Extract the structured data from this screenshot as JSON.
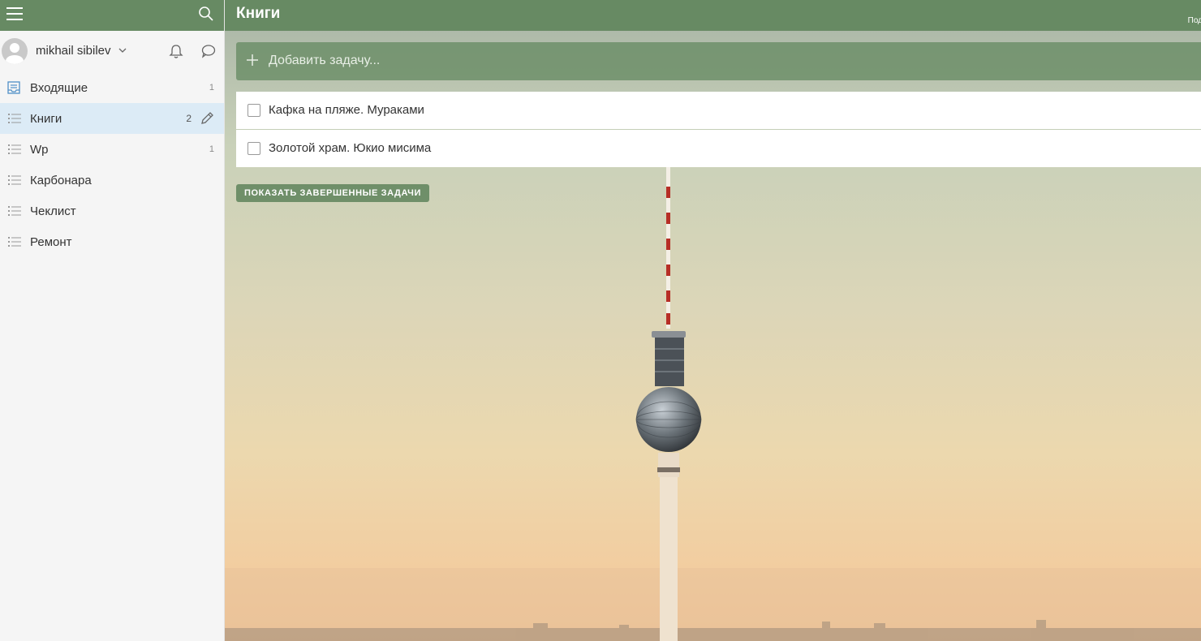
{
  "user": {
    "name": "mikhail sibilev"
  },
  "sidebar": {
    "items": [
      {
        "label": "Входящие",
        "count": "1",
        "icon": "inbox-icon",
        "active": false
      },
      {
        "label": "Книги",
        "count": "2",
        "icon": "list-icon",
        "active": true
      },
      {
        "label": "Wp",
        "count": "1",
        "icon": "list-icon",
        "active": false
      },
      {
        "label": "Карбонара",
        "count": "",
        "icon": "list-icon",
        "active": false
      },
      {
        "label": "Чеклист",
        "count": "",
        "icon": "list-icon",
        "active": false
      },
      {
        "label": "Ремонт",
        "count": "",
        "icon": "list-icon",
        "active": false
      }
    ]
  },
  "main": {
    "title": "Книги",
    "header_right": "Под",
    "add_task": {
      "placeholder": "Добавить задачу..."
    },
    "tasks": [
      {
        "title": "Кафка на пляже. Мураками",
        "done": false
      },
      {
        "title": "Золотой храм. Юкио мисима",
        "done": false
      }
    ],
    "show_completed_label": "ПОКАЗАТЬ ЗАВЕРШЕННЫЕ ЗАДАЧИ"
  },
  "colors": {
    "accent": "#678a63",
    "active_item": "#dcebf6",
    "sidebar_bg": "#f5f5f5"
  }
}
